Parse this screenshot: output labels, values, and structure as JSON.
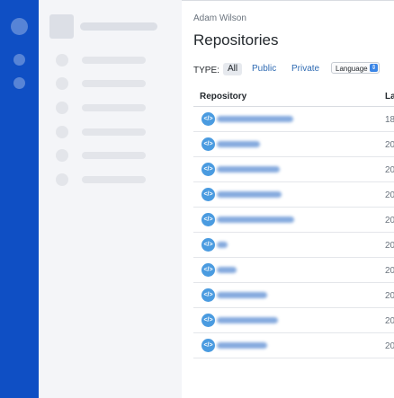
{
  "header": {
    "owner": "Adam Wilson",
    "title": "Repositories"
  },
  "filters": {
    "type_label": "TYPE:",
    "options": [
      "All",
      "Public",
      "Private"
    ],
    "selected": "All",
    "language_select": "Language"
  },
  "table": {
    "columns": [
      "Repository",
      "La"
    ],
    "rows": [
      {
        "date": "18"
      },
      {
        "date": "20"
      },
      {
        "date": "20"
      },
      {
        "date": "20"
      },
      {
        "date": "20"
      },
      {
        "date": "20"
      },
      {
        "date": "20"
      },
      {
        "date": "20"
      },
      {
        "date": "20"
      },
      {
        "date": "20"
      }
    ]
  },
  "icons": {
    "repo": "code-icon",
    "chevron": "chevron-updown-icon"
  },
  "colors": {
    "rail": "#0f4fc4",
    "sidebar": "#f4f5f8",
    "link": "#2f6bb3",
    "repo_icon": "#4a9be0"
  }
}
